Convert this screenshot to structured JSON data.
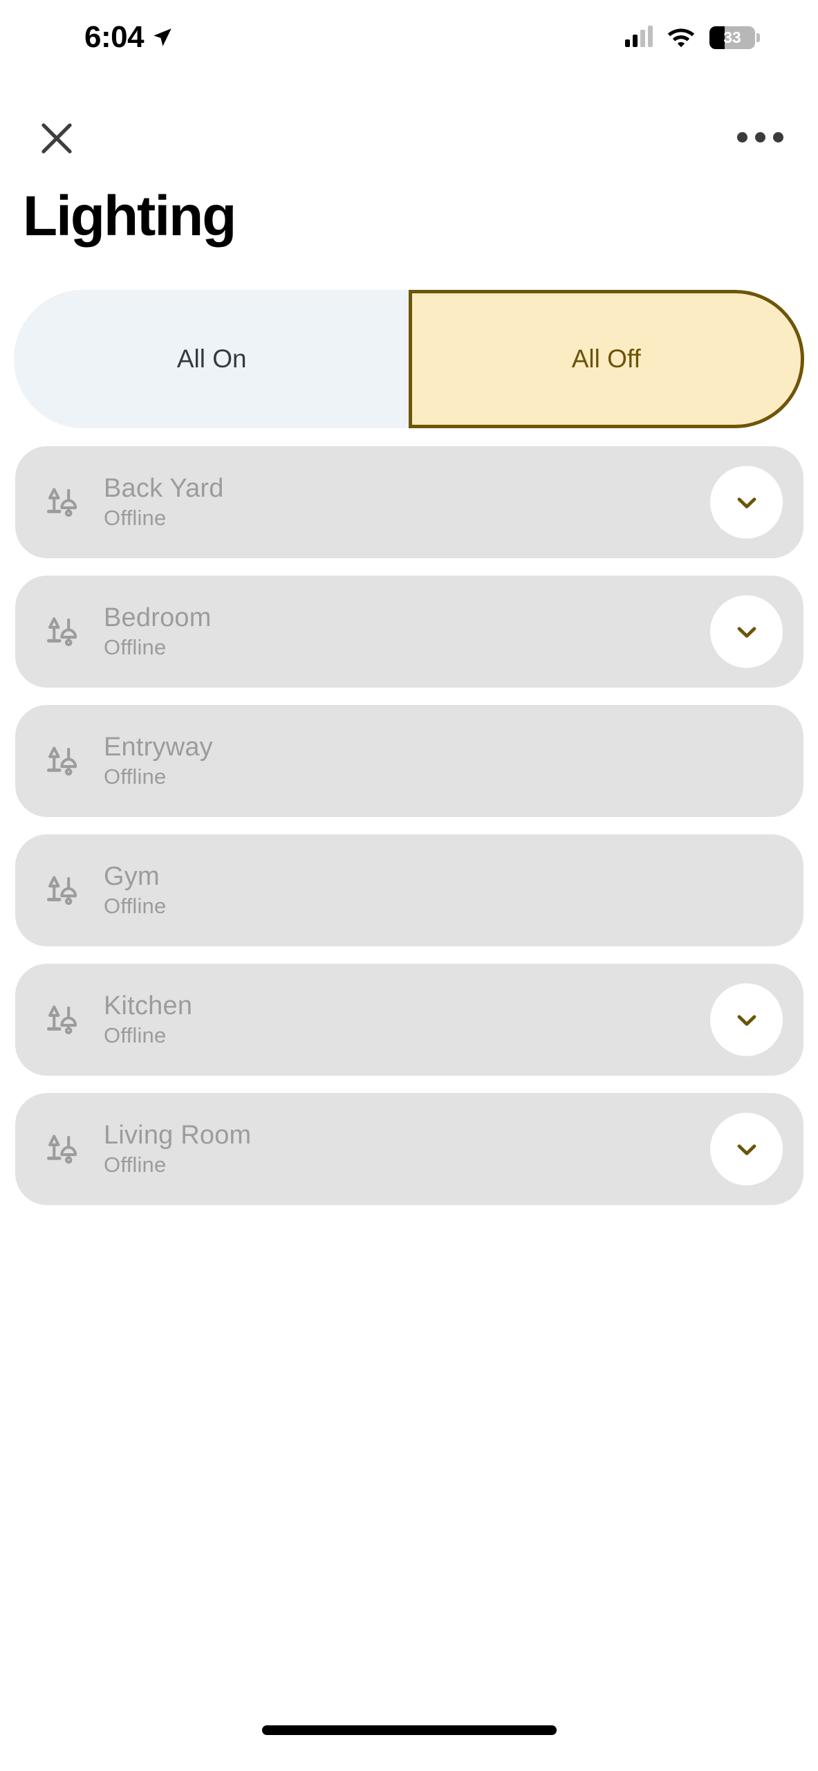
{
  "status_bar": {
    "time": "6:04",
    "location_icon": "location-arrow-icon",
    "cellular_icon": "cellular-signal-icon",
    "wifi_icon": "wifi-icon",
    "battery_percent": "33",
    "battery_level": 33
  },
  "nav": {
    "close_icon": "close-icon",
    "more_icon": "more-options-icon"
  },
  "header": {
    "title": "Lighting"
  },
  "segmented_control": {
    "selected": "All Off",
    "options": [
      {
        "label": "All On",
        "selected": false
      },
      {
        "label": "All Off",
        "selected": true
      }
    ],
    "colors": {
      "inactive_bg": "#eef3f7",
      "inactive_text": "#343a40",
      "active_bg": "#fcecc4",
      "active_border": "#6f5508",
      "active_text": "#6b5308"
    }
  },
  "devices": {
    "icon": "lamp-icon",
    "row_bg": "#e2e2e2",
    "text_color": "#9c9c9c",
    "chevron_color": "#6b5308",
    "items": [
      {
        "name": "Back Yard",
        "status": "Offline",
        "has_chevron": true
      },
      {
        "name": "Bedroom",
        "status": "Offline",
        "has_chevron": true
      },
      {
        "name": "Entryway",
        "status": "Offline",
        "has_chevron": false
      },
      {
        "name": "Gym",
        "status": "Offline",
        "has_chevron": false
      },
      {
        "name": "Kitchen",
        "status": "Offline",
        "has_chevron": true
      },
      {
        "name": "Living Room",
        "status": "Offline",
        "has_chevron": true
      }
    ]
  },
  "home_indicator": "home-indicator"
}
